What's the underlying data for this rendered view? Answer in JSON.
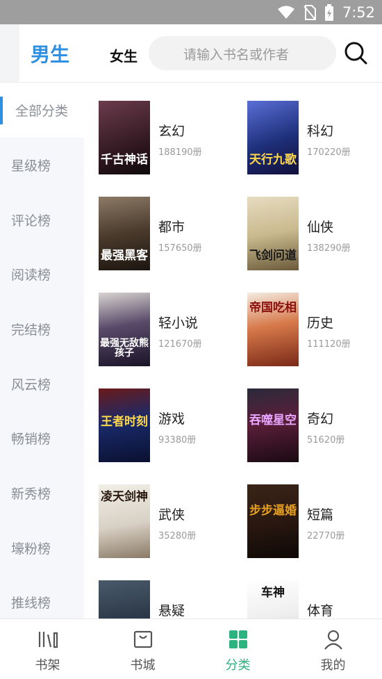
{
  "status_bar": {
    "time": "7:52"
  },
  "header": {
    "tab_male": "男生",
    "tab_female": "女生",
    "search_placeholder": "请输入书名或作者"
  },
  "sidebar": {
    "items": [
      {
        "label": "全部分类",
        "active": true
      },
      {
        "label": "星级榜"
      },
      {
        "label": "评论榜"
      },
      {
        "label": "阅读榜"
      },
      {
        "label": "完结榜"
      },
      {
        "label": "风云榜"
      },
      {
        "label": "畅销榜"
      },
      {
        "label": "新秀榜"
      },
      {
        "label": "壕粉榜"
      },
      {
        "label": "推线榜"
      }
    ]
  },
  "categories": [
    {
      "name": "玄幻",
      "count": "188190册",
      "cover_text": "千古神话",
      "cover_bg": "#3a1f2a"
    },
    {
      "name": "科幻",
      "count": "170220册",
      "cover_text": "天行九歌",
      "cover_bg": "#1e2f7a"
    },
    {
      "name": "都市",
      "count": "157650册",
      "cover_text": "最强黑客",
      "cover_bg": "#4a3a2c"
    },
    {
      "name": "仙侠",
      "count": "138290册",
      "cover_text": "飞剑问道",
      "cover_bg": "#c9b98e"
    },
    {
      "name": "轻小说",
      "count": "121670册",
      "cover_text": "最强无敌熊孩子",
      "cover_bg": "#2b2540"
    },
    {
      "name": "历史",
      "count": "111120册",
      "cover_text": "帝国吃相",
      "cover_bg": "#b5452a"
    },
    {
      "name": "游戏",
      "count": "93380册",
      "cover_text": "王者时刻",
      "cover_bg": "#1a2a6a"
    },
    {
      "name": "奇幻",
      "count": "51620册",
      "cover_text": "吞噬星空",
      "cover_bg": "#5a1e3a"
    },
    {
      "name": "武侠",
      "count": "35280册",
      "cover_text": "凌天剑神",
      "cover_bg": "#e8e4dc"
    },
    {
      "name": "短篇",
      "count": "22770册",
      "cover_text": "步步逼婚",
      "cover_bg": "#2a1810"
    },
    {
      "name": "悬疑",
      "count": "",
      "cover_text": "",
      "cover_bg": "#2d3a4a"
    },
    {
      "name": "体育",
      "count": "",
      "cover_text": "车神",
      "cover_bg": "#eeeeee"
    }
  ],
  "bottom_nav": [
    {
      "label": "书架",
      "icon": "bookshelf-icon"
    },
    {
      "label": "书城",
      "icon": "bookstore-icon"
    },
    {
      "label": "分类",
      "icon": "category-grid-icon",
      "active": true
    },
    {
      "label": "我的",
      "icon": "profile-icon"
    }
  ],
  "colors": {
    "accent_blue": "#2f8fe0",
    "accent_green": "#2db37f"
  }
}
